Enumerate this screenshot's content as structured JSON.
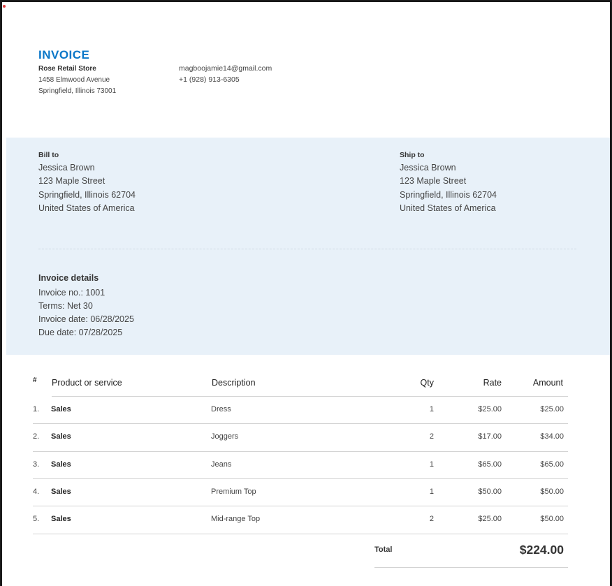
{
  "invoice": {
    "title": "INVOICE",
    "store": {
      "name": "Rose Retail Store",
      "address_line1": "1458 Elmwood Avenue",
      "address_line2": "Springfield, Illinois 73001",
      "email": "magboojamie14@gmail.com",
      "phone": "+1 (928) 913-6305"
    }
  },
  "bill_to": {
    "label": "Bill to",
    "lines": [
      "Jessica Brown",
      "123 Maple Street",
      "Springfield, Illinois 62704",
      "United States of America"
    ]
  },
  "ship_to": {
    "label": "Ship to",
    "lines": [
      "Jessica Brown",
      "123 Maple Street",
      "Springfield, Illinois 62704",
      "United States of America"
    ]
  },
  "details": {
    "title": "Invoice details",
    "lines": [
      "Invoice no.: 1001",
      "Terms: Net 30",
      "Invoice date: 06/28/2025",
      "Due date: 07/28/2025"
    ]
  },
  "table": {
    "headers": {
      "number": "#",
      "product": "Product or service",
      "description": "Description",
      "qty": "Qty",
      "rate": "Rate",
      "amount": "Amount"
    },
    "rows": [
      {
        "number": "1.",
        "product": "Sales",
        "description": "Dress",
        "qty": "1",
        "rate": "$25.00",
        "amount": "$25.00"
      },
      {
        "number": "2.",
        "product": "Sales",
        "description": "Joggers",
        "qty": "2",
        "rate": "$17.00",
        "amount": "$34.00"
      },
      {
        "number": "3.",
        "product": "Sales",
        "description": "Jeans",
        "qty": "1",
        "rate": "$65.00",
        "amount": "$65.00"
      },
      {
        "number": "4.",
        "product": "Sales",
        "description": "Premium Top",
        "qty": "1",
        "rate": "$50.00",
        "amount": "$50.00"
      },
      {
        "number": "5.",
        "product": "Sales",
        "description": "Mid-range Top",
        "qty": "2",
        "rate": "$25.00",
        "amount": "$50.00"
      }
    ],
    "total_label": "Total",
    "total_value": "$224.00"
  },
  "colors": {
    "accent": "#0a77c8",
    "panel_background": "#e8f1f9"
  }
}
